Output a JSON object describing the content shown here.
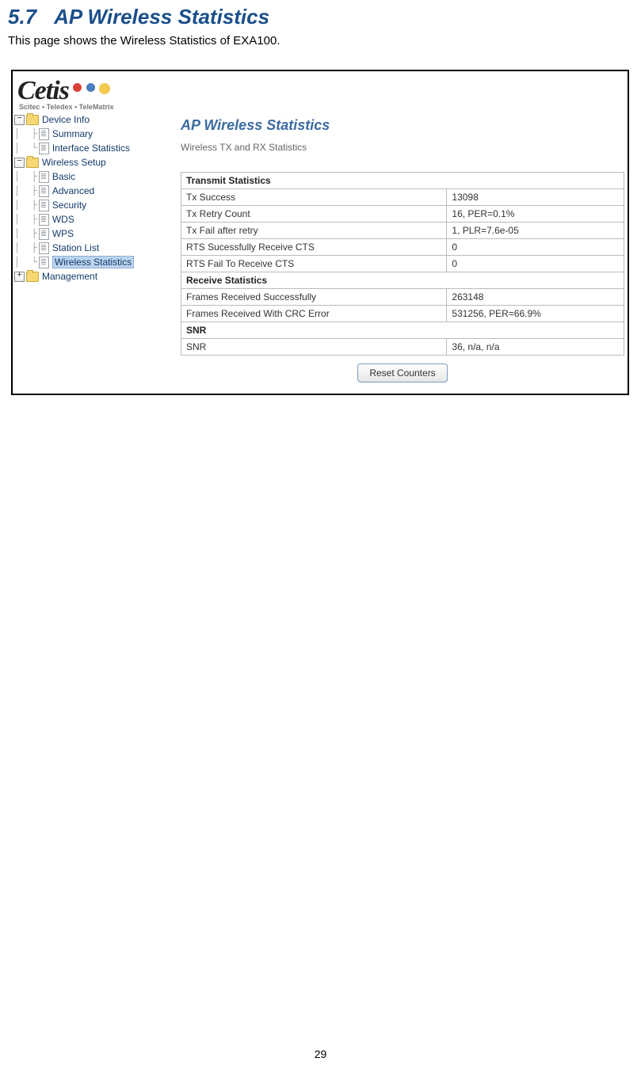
{
  "section": {
    "number": "5.7",
    "title": "AP Wireless Statistics",
    "intro": "This page shows the Wireless Statistics of EXA100."
  },
  "logo": {
    "word": "Cetis",
    "tagline": "Scitec • Teledex • TeleMatrix"
  },
  "nav": {
    "device_info": "Device Info",
    "summary": "Summary",
    "interface_statistics": "Interface Statistics",
    "wireless_setup": "Wireless Setup",
    "basic": "Basic",
    "advanced": "Advanced",
    "security": "Security",
    "wds": "WDS",
    "wps": "WPS",
    "station_list": "Station List",
    "wireless_statistics": "Wireless Statistics",
    "management": "Management"
  },
  "content": {
    "title": "AP Wireless Statistics",
    "subtitle": "Wireless TX and RX Statistics",
    "transmit_header": "Transmit Statistics",
    "tx": [
      {
        "label": "Tx Success",
        "value": "13098"
      },
      {
        "label": "Tx Retry Count",
        "value": "16, PER=0.1%"
      },
      {
        "label": "Tx Fail after retry",
        "value": "1, PLR=7.6e-05"
      },
      {
        "label": "RTS Sucessfully Receive CTS",
        "value": "0"
      },
      {
        "label": "RTS Fail To Receive CTS",
        "value": "0"
      }
    ],
    "receive_header": "Receive Statistics",
    "rx": [
      {
        "label": "Frames Received Successfully",
        "value": "263148"
      },
      {
        "label": "Frames Received With CRC Error",
        "value": "531256, PER=66.9%"
      }
    ],
    "snr_header": "SNR",
    "snr": {
      "label": "SNR",
      "value": "36, n/a, n/a"
    },
    "reset_button": "Reset Counters"
  },
  "page_number": "29"
}
